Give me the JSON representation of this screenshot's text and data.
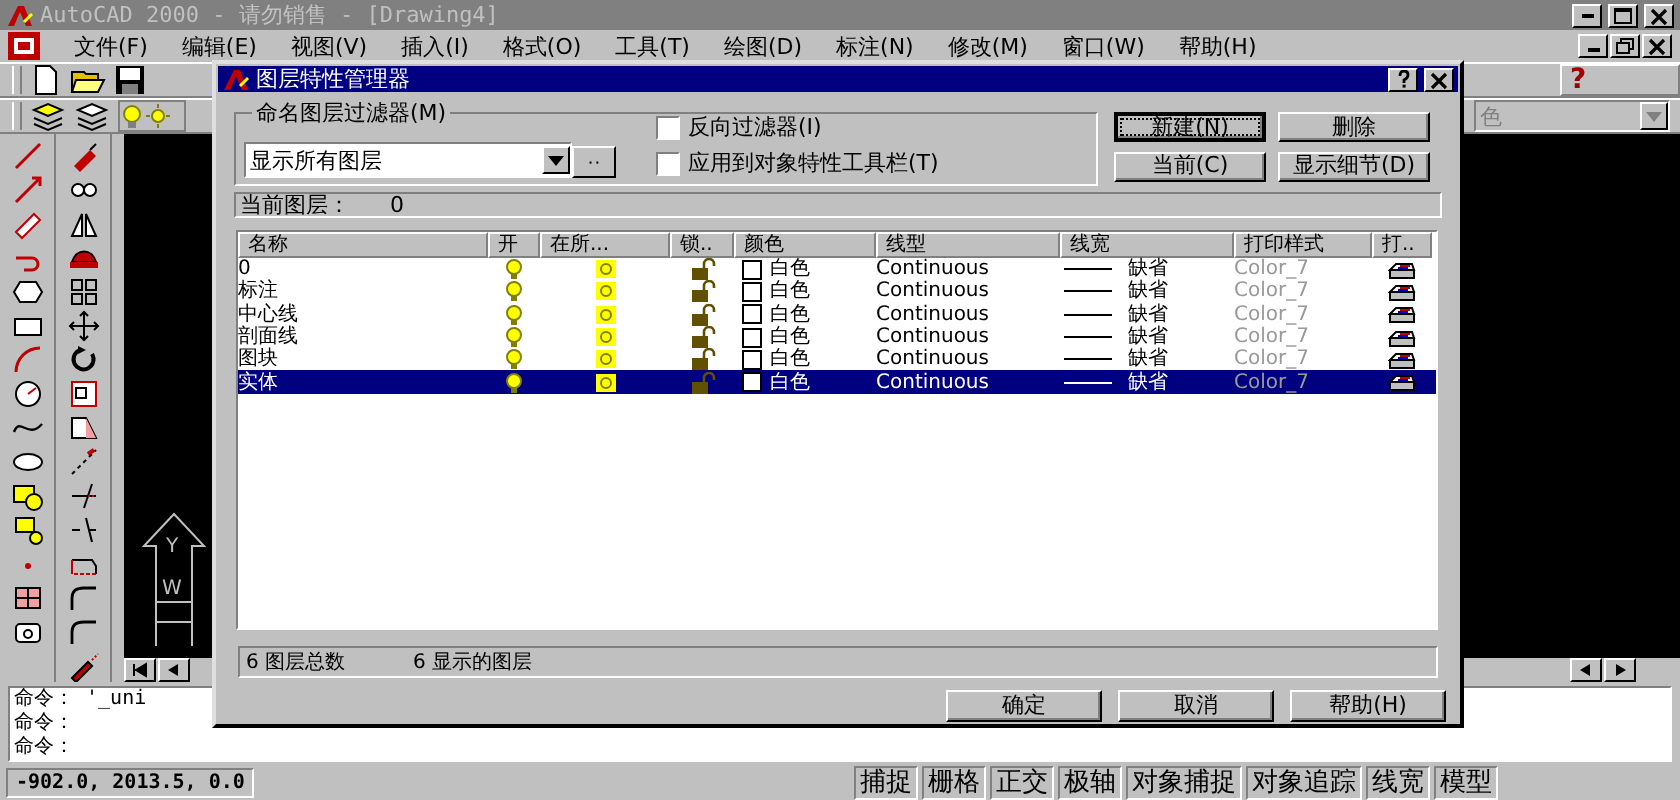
{
  "app_window": {
    "title": "AutoCAD 2000 - 请勿销售 - [Drawing4]"
  },
  "menu_bar": [
    "文件(F)",
    "编辑(E)",
    "视图(V)",
    "插入(I)",
    "格式(O)",
    "工具(T)",
    "绘图(D)",
    "标注(N)",
    "修改(M)",
    "窗口(W)",
    "帮助(H)"
  ],
  "toolbar": {
    "help_glyph": "?",
    "color_dropdown": "色"
  },
  "ucs_icon": {
    "y_label": "Y",
    "w_label": "W"
  },
  "command_lines": [
    "命令： '_uni",
    "命令：",
    "命令："
  ],
  "status_bar": {
    "coordinates": "-902.0, 2013.5, 0.0",
    "toggles": [
      "捕捉",
      "栅格",
      "正交",
      "极轴",
      "对象捕捉",
      "对象追踪",
      "线宽",
      "模型"
    ]
  },
  "dialog": {
    "title": "图层特性管理器",
    "filter_group": {
      "label": "命名图层过滤器(M)",
      "value": "显示所有图层",
      "browse_button": "··"
    },
    "checkboxes": [
      {
        "label": "反向过滤器(I)",
        "checked": false
      },
      {
        "label": "应用到对象特性工具栏(T)",
        "checked": false
      }
    ],
    "buttons": [
      {
        "label": "新建(N)",
        "focused": true
      },
      {
        "label": "删除",
        "focused": false
      },
      {
        "label": "当前(C)",
        "focused": false
      },
      {
        "label": "显示细节(D)",
        "focused": false
      }
    ],
    "current_layer_label": "当前图层：",
    "current_layer_value": "0",
    "columns": [
      "名称",
      "开",
      "在所...",
      "锁..",
      "颜色",
      "线型",
      "线宽",
      "打印样式",
      "打.."
    ],
    "rows": [
      {
        "name": "0",
        "on": true,
        "frozen": false,
        "locked": false,
        "color_name": "白色",
        "linetype": "Continuous",
        "lineweight": "缺省",
        "plot_style": "Color_7",
        "selected": false
      },
      {
        "name": "标注",
        "on": true,
        "frozen": false,
        "locked": false,
        "color_name": "白色",
        "linetype": "Continuous",
        "lineweight": "缺省",
        "plot_style": "Color_7",
        "selected": false
      },
      {
        "name": "中心线",
        "on": true,
        "frozen": false,
        "locked": false,
        "color_name": "白色",
        "linetype": "Continuous",
        "lineweight": "缺省",
        "plot_style": "Color_7",
        "selected": false
      },
      {
        "name": "剖面线",
        "on": true,
        "frozen": false,
        "locked": false,
        "color_name": "白色",
        "linetype": "Continuous",
        "lineweight": "缺省",
        "plot_style": "Color_7",
        "selected": false
      },
      {
        "name": "图块",
        "on": true,
        "frozen": false,
        "locked": false,
        "color_name": "白色",
        "linetype": "Continuous",
        "lineweight": "缺省",
        "plot_style": "Color_7",
        "selected": false
      },
      {
        "name": "实体",
        "on": true,
        "frozen": false,
        "locked": false,
        "color_name": "白色",
        "linetype": "Continuous",
        "lineweight": "缺省",
        "plot_style": "Color_7",
        "selected": true
      }
    ],
    "footer": [
      {
        "count": "6",
        "label": "图层总数"
      },
      {
        "count": "6",
        "label": "显示的图层"
      }
    ],
    "bottom_buttons": [
      "确定",
      "取消",
      "帮助(H)"
    ]
  }
}
